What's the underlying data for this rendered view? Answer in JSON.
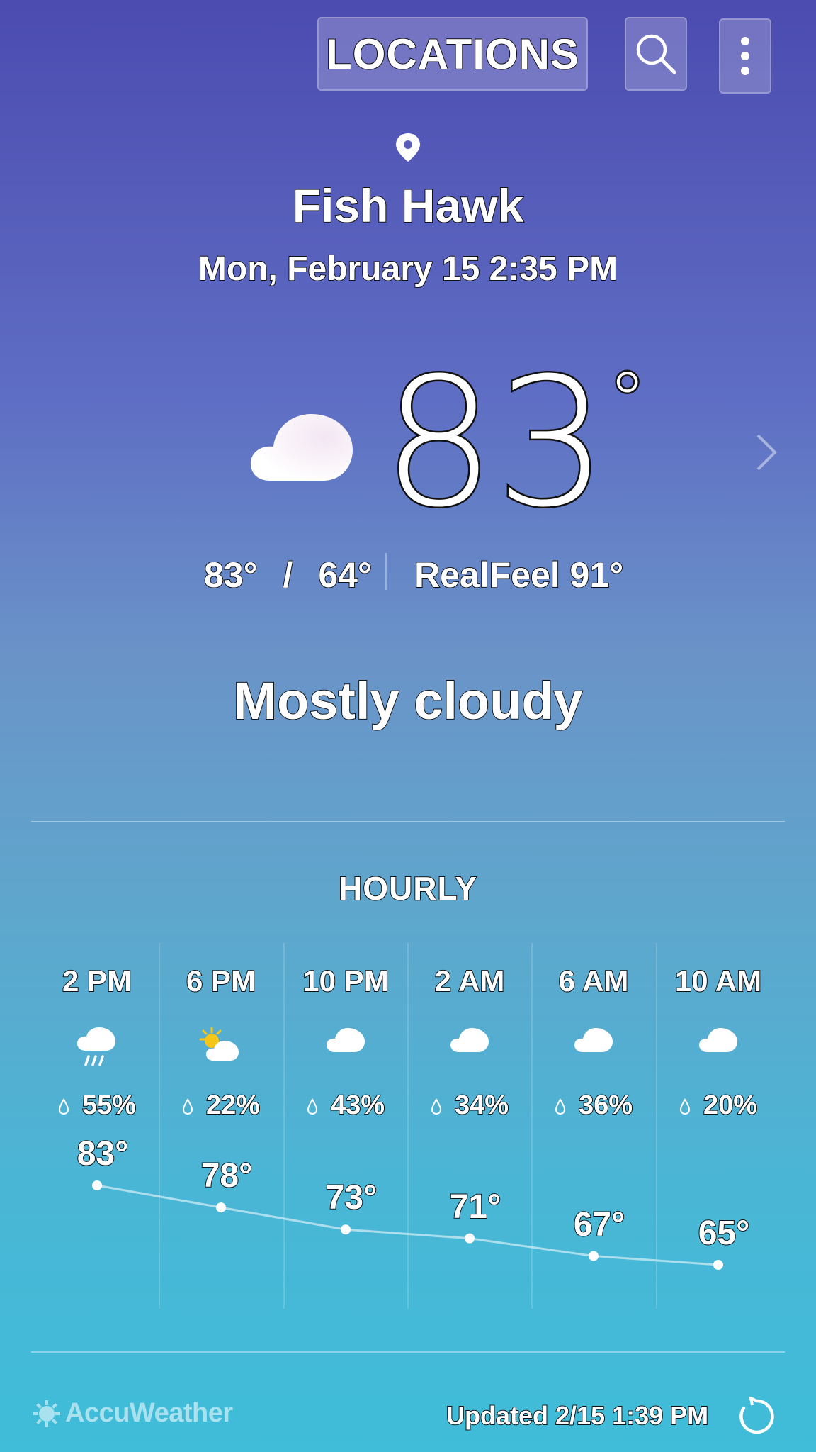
{
  "header": {
    "locations_label": "LOCATIONS",
    "search_icon": "search-icon",
    "menu_icon": "more-vert-icon"
  },
  "location": {
    "pin_icon": "location-pin-icon",
    "city": "Fish Hawk",
    "datetime": "Mon, February 15 2:35 PM"
  },
  "current": {
    "icon": "cloud-icon",
    "temp": "83",
    "degree": "°",
    "high": "83°",
    "separator": "/",
    "low": "64°",
    "realfeel": "RealFeel 91°",
    "condition": "Mostly cloudy"
  },
  "hourly": {
    "title": "HOURLY",
    "items": [
      {
        "time": "2 PM",
        "icon": "rain-cloud-icon",
        "precip": "55%",
        "temp": "83°",
        "value": 83
      },
      {
        "time": "6 PM",
        "icon": "partly-sunny-icon",
        "precip": "22%",
        "temp": "78°",
        "value": 78
      },
      {
        "time": "10 PM",
        "icon": "cloud-icon",
        "precip": "43%",
        "temp": "73°",
        "value": 73
      },
      {
        "time": "2 AM",
        "icon": "cloud-icon",
        "precip": "34%",
        "temp": "71°",
        "value": 71
      },
      {
        "time": "6 AM",
        "icon": "cloud-icon",
        "precip": "36%",
        "temp": "67°",
        "value": 67
      },
      {
        "time": "10 AM",
        "icon": "cloud-icon",
        "precip": "20%",
        "temp": "65°",
        "value": 65
      }
    ]
  },
  "footer": {
    "brand": "AccuWeather",
    "updated": "Updated  2/15  1:39 PM",
    "refresh_icon": "refresh-icon"
  },
  "colors": {
    "gradient_top": "#4c4bb0",
    "gradient_bottom": "#3fbdd9",
    "sun": "#f5c518"
  }
}
